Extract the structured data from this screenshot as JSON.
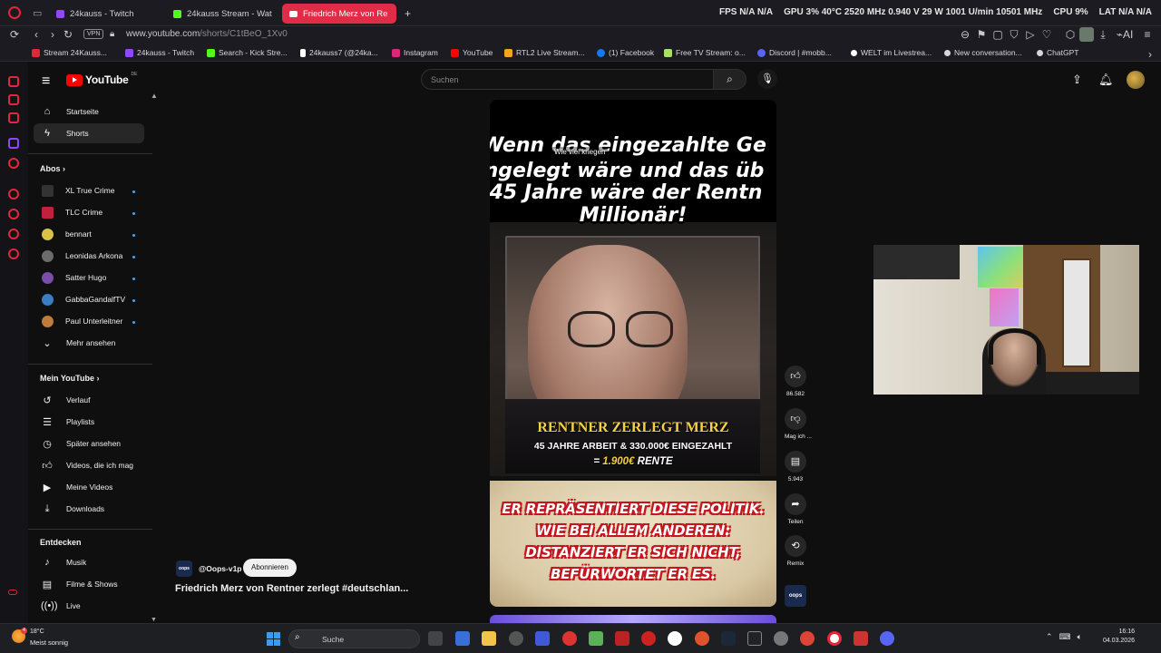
{
  "browser": {
    "tabs": [
      {
        "label": "24kauss - Twitch",
        "icon": "twitch-icon"
      },
      {
        "label": "24kauss Stream - Wat",
        "icon": "kick-icon"
      },
      {
        "label": "Friedrich Merz von Re",
        "icon": "youtube-icon",
        "active": true
      }
    ],
    "new_tab": "+",
    "stats": {
      "fps": "FPS N/A N/A",
      "gpu": "GPU 3% 40°C 2520 MHz 0.940 V 29 W 1001 U/min 10501 MHz",
      "cpu": "CPU 9%",
      "lat": "LAT N/A N/A"
    },
    "vpn": "VPN",
    "url_host": "www.youtube.com",
    "url_path": "/shorts/C1tBeO_1Xv0",
    "bookmarks": [
      {
        "label": "Stream 24Kauss...",
        "color": "#e4263a"
      },
      {
        "label": "24kauss - Twitch",
        "color": "#9146ff"
      },
      {
        "label": "Search - Kick Stre...",
        "color": "#53fc18"
      },
      {
        "label": "24kauss7 (@24ka...",
        "color": "#ffffff"
      },
      {
        "label": "Instagram",
        "color": "#d6297a"
      },
      {
        "label": "YouTube",
        "color": "#ff0000"
      },
      {
        "label": "RTL2 Live Stream...",
        "color": "#f2a51a"
      },
      {
        "label": "(1) Facebook",
        "color": "#1877f2"
      },
      {
        "label": "Free TV Stream: o...",
        "color": "#a6e06a"
      },
      {
        "label": "Discord | #mobb...",
        "color": "#5865f2"
      },
      {
        "label": "WELT im Livestrea...",
        "color": "#ffffff"
      },
      {
        "label": "New conversation...",
        "color": "#d6d6d6"
      },
      {
        "label": "ChatGPT",
        "color": "#d6d6d6"
      }
    ]
  },
  "youtube": {
    "logo": "YouTube",
    "logo_region": "DE",
    "search_placeholder": "Suchen",
    "sidebar": {
      "main": [
        {
          "label": "Startseite",
          "icon": "home-icon"
        },
        {
          "label": "Shorts",
          "icon": "shorts-icon",
          "selected": true
        }
      ],
      "subs_header": "Abos",
      "channels": [
        {
          "label": "XL True Crime",
          "color": "#333333"
        },
        {
          "label": "TLC Crime",
          "color": "#c0213d"
        },
        {
          "label": "bennart",
          "color": "#d9c24a"
        },
        {
          "label": "Leonidas Arkona",
          "color": "#6b6b6b"
        },
        {
          "label": "Satter Hugo",
          "color": "#7a4ea8"
        },
        {
          "label": "GabbaGandalfTV",
          "color": "#3a7ec2"
        },
        {
          "label": "Paul Unterleitner",
          "color": "#c07a3a"
        }
      ],
      "more": "Mehr ansehen",
      "my_header": "Mein YouTube",
      "my_items": [
        {
          "label": "Verlauf",
          "icon": "history-icon"
        },
        {
          "label": "Playlists",
          "icon": "playlist-icon"
        },
        {
          "label": "Später ansehen",
          "icon": "clock-icon"
        },
        {
          "label": "Videos, die ich mag",
          "icon": "like-icon"
        },
        {
          "label": "Meine Videos",
          "icon": "video-icon"
        },
        {
          "label": "Downloads",
          "icon": "download-icon"
        }
      ],
      "explore_header": "Entdecken",
      "explore_items": [
        {
          "label": "Musik",
          "icon": "music-icon"
        },
        {
          "label": "Filme & Shows",
          "icon": "film-icon"
        },
        {
          "label": "Live",
          "icon": "live-icon"
        }
      ]
    },
    "short": {
      "tooltip": "Wie viel kriegen",
      "top_caption": [
        "Wenn das eingezahlte Ge",
        "ngelegt wäre und das üb",
        "45 Jahre wäre der Rentn",
        "Millionär!"
      ],
      "headline": "RENTNER ZERLEGT MERZ",
      "sub1": "45 JAHRE ARBEIT & 330.000€ EINGEZAHLT",
      "sub2_prefix": "= ",
      "sub2_highlight": "1.900€",
      "sub2_suffix": " RENTE",
      "bottom_caption": [
        "ER REPRÄSENTIERT DIESE POLITIK.",
        "WIE BEI ALLEM ANDEREN:",
        "DISTANZIERT ER SICH NICHT,",
        "BEFÜRWORTET ER ES."
      ]
    },
    "actions": {
      "likes": "86.582",
      "dislike": "Mag ich ...",
      "comments": "5.943",
      "share": "Teilen",
      "remix": "Remix"
    },
    "channel": {
      "avatar_text": "oops",
      "handle": "@Oops-v1p",
      "subscribe": "Abonnieren",
      "title": "Friedrich Merz von Rentner zerlegt #deutschlan..."
    }
  },
  "taskbar": {
    "temp": "18°C",
    "weather": "Meist sonnig",
    "badge": "4",
    "search": "Suche",
    "time": "16:16",
    "date": "04.03.2026"
  }
}
